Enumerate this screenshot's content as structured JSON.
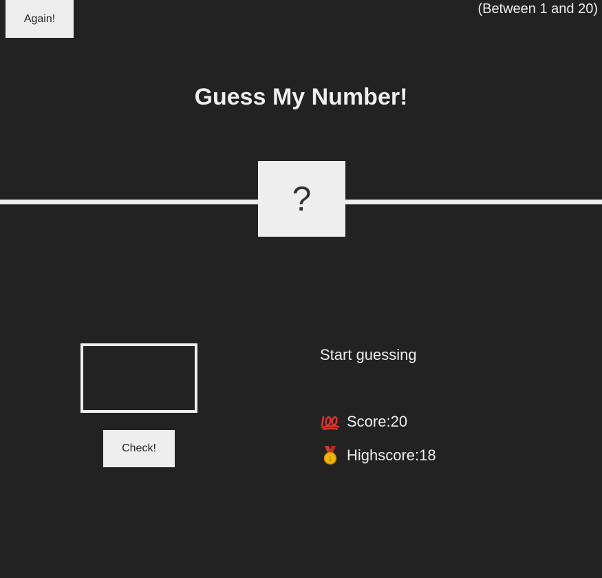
{
  "buttons": {
    "again_label": "Again!",
    "check_label": "Check!"
  },
  "header": {
    "range_hint": "(Between 1 and 20)",
    "title": "Guess My Number!"
  },
  "secret": {
    "display": "?"
  },
  "guess": {
    "value": "",
    "placeholder": ""
  },
  "status": {
    "message": "Start guessing",
    "score_label": "Score: ",
    "score_value": "20",
    "highscore_label": "Highscore: ",
    "highscore_value": "18",
    "score_icon": "hundred-points-icon",
    "highscore_icon": "medal-icon"
  },
  "colors": {
    "background": "#222222",
    "foreground": "#eeeeee",
    "accent_red": "#d9362b",
    "accent_gold": "#f5b500"
  }
}
